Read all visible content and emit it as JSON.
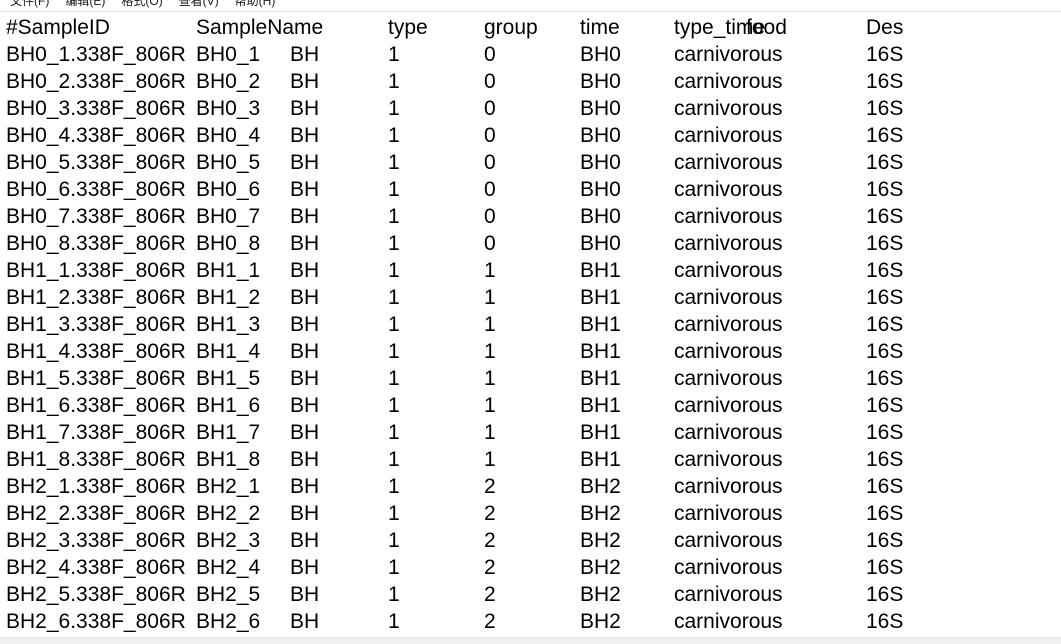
{
  "window": {
    "app": "notepad",
    "background_color": "#ffffff",
    "text_color": "#000000"
  },
  "menubar": {
    "items": [
      {
        "label": "文件(F)",
        "name": "menu-file"
      },
      {
        "label": "编辑(E)",
        "name": "menu-edit"
      },
      {
        "label": "格式(O)",
        "name": "menu-format"
      },
      {
        "label": "查看(V)",
        "name": "menu-view"
      },
      {
        "label": "帮助(H)",
        "name": "menu-help"
      }
    ]
  },
  "document": {
    "columns": [
      "#SampleID",
      "SampleName",
      "type",
      "group",
      "time",
      "type_time",
      "food",
      "Des"
    ],
    "header": {
      "c0": "#SampleID",
      "c1": "SampleName",
      "c3": "type",
      "c4": "group",
      "c5": "time",
      "c6": "type_time",
      "c7": "food",
      "c8": "Des"
    },
    "rows": [
      {
        "c0": "BH0_1.338F_806R",
        "c1": "BH0_1",
        "c2": "BH",
        "c3": "1",
        "c4": "0",
        "c5": "BH0",
        "c6": "carnivorous",
        "c8": "16S"
      },
      {
        "c0": "BH0_2.338F_806R",
        "c1": "BH0_2",
        "c2": "BH",
        "c3": "1",
        "c4": "0",
        "c5": "BH0",
        "c6": "carnivorous",
        "c8": "16S"
      },
      {
        "c0": "BH0_3.338F_806R",
        "c1": "BH0_3",
        "c2": "BH",
        "c3": "1",
        "c4": "0",
        "c5": "BH0",
        "c6": "carnivorous",
        "c8": "16S"
      },
      {
        "c0": "BH0_4.338F_806R",
        "c1": "BH0_4",
        "c2": "BH",
        "c3": "1",
        "c4": "0",
        "c5": "BH0",
        "c6": "carnivorous",
        "c8": "16S"
      },
      {
        "c0": "BH0_5.338F_806R",
        "c1": "BH0_5",
        "c2": "BH",
        "c3": "1",
        "c4": "0",
        "c5": "BH0",
        "c6": "carnivorous",
        "c8": "16S"
      },
      {
        "c0": "BH0_6.338F_806R",
        "c1": "BH0_6",
        "c2": "BH",
        "c3": "1",
        "c4": "0",
        "c5": "BH0",
        "c6": "carnivorous",
        "c8": "16S"
      },
      {
        "c0": "BH0_7.338F_806R",
        "c1": "BH0_7",
        "c2": "BH",
        "c3": "1",
        "c4": "0",
        "c5": "BH0",
        "c6": "carnivorous",
        "c8": "16S"
      },
      {
        "c0": "BH0_8.338F_806R",
        "c1": "BH0_8",
        "c2": "BH",
        "c3": "1",
        "c4": "0",
        "c5": "BH0",
        "c6": "carnivorous",
        "c8": "16S"
      },
      {
        "c0": "BH1_1.338F_806R",
        "c1": "BH1_1",
        "c2": "BH",
        "c3": "1",
        "c4": "1",
        "c5": "BH1",
        "c6": "carnivorous",
        "c8": "16S"
      },
      {
        "c0": "BH1_2.338F_806R",
        "c1": "BH1_2",
        "c2": "BH",
        "c3": "1",
        "c4": "1",
        "c5": "BH1",
        "c6": "carnivorous",
        "c8": "16S"
      },
      {
        "c0": "BH1_3.338F_806R",
        "c1": "BH1_3",
        "c2": "BH",
        "c3": "1",
        "c4": "1",
        "c5": "BH1",
        "c6": "carnivorous",
        "c8": "16S"
      },
      {
        "c0": "BH1_4.338F_806R",
        "c1": "BH1_4",
        "c2": "BH",
        "c3": "1",
        "c4": "1",
        "c5": "BH1",
        "c6": "carnivorous",
        "c8": "16S"
      },
      {
        "c0": "BH1_5.338F_806R",
        "c1": "BH1_5",
        "c2": "BH",
        "c3": "1",
        "c4": "1",
        "c5": "BH1",
        "c6": "carnivorous",
        "c8": "16S"
      },
      {
        "c0": "BH1_6.338F_806R",
        "c1": "BH1_6",
        "c2": "BH",
        "c3": "1",
        "c4": "1",
        "c5": "BH1",
        "c6": "carnivorous",
        "c8": "16S"
      },
      {
        "c0": "BH1_7.338F_806R",
        "c1": "BH1_7",
        "c2": "BH",
        "c3": "1",
        "c4": "1",
        "c5": "BH1",
        "c6": "carnivorous",
        "c8": "16S"
      },
      {
        "c0": "BH1_8.338F_806R",
        "c1": "BH1_8",
        "c2": "BH",
        "c3": "1",
        "c4": "1",
        "c5": "BH1",
        "c6": "carnivorous",
        "c8": "16S"
      },
      {
        "c0": "BH2_1.338F_806R",
        "c1": "BH2_1",
        "c2": "BH",
        "c3": "1",
        "c4": "2",
        "c5": "BH2",
        "c6": "carnivorous",
        "c8": "16S"
      },
      {
        "c0": "BH2_2.338F_806R",
        "c1": "BH2_2",
        "c2": "BH",
        "c3": "1",
        "c4": "2",
        "c5": "BH2",
        "c6": "carnivorous",
        "c8": "16S"
      },
      {
        "c0": "BH2_3.338F_806R",
        "c1": "BH2_3",
        "c2": "BH",
        "c3": "1",
        "c4": "2",
        "c5": "BH2",
        "c6": "carnivorous",
        "c8": "16S"
      },
      {
        "c0": "BH2_4.338F_806R",
        "c1": "BH2_4",
        "c2": "BH",
        "c3": "1",
        "c4": "2",
        "c5": "BH2",
        "c6": "carnivorous",
        "c8": "16S"
      },
      {
        "c0": "BH2_5.338F_806R",
        "c1": "BH2_5",
        "c2": "BH",
        "c3": "1",
        "c4": "2",
        "c5": "BH2",
        "c6": "carnivorous",
        "c8": "16S"
      },
      {
        "c0": "BH2_6.338F_806R",
        "c1": "BH2_6",
        "c2": "BH",
        "c3": "1",
        "c4": "2",
        "c5": "BH2",
        "c6": "carnivorous",
        "c8": "16S"
      }
    ]
  }
}
